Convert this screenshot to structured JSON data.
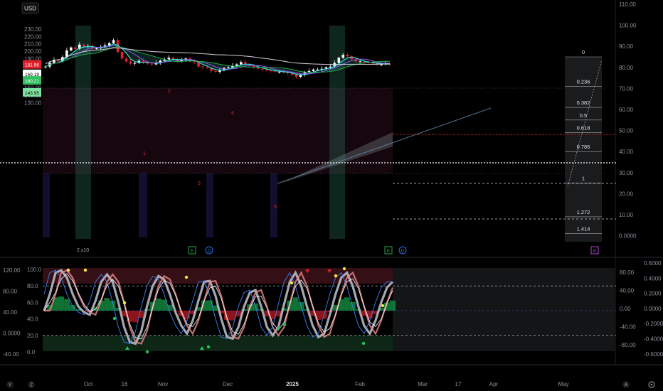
{
  "currency_button": "USD",
  "price_axis": {
    "labels": [
      "230.00",
      "220.00",
      "210.00",
      "200.00",
      "190.00",
      "180.00",
      "170.00",
      "160.00",
      "150.00",
      "140.00",
      "130.00"
    ],
    "values": [
      230,
      220,
      210,
      200,
      190,
      180,
      170,
      160,
      150,
      140,
      130
    ]
  },
  "right_axis": {
    "labels": [
      "110.00",
      "100.00",
      "90.00",
      "80.00",
      "70.00",
      "60.00",
      "50.00",
      "40.00",
      "30.00",
      "20.00",
      "10.00",
      "0.0000"
    ],
    "values": [
      110,
      100,
      90,
      80,
      70,
      60,
      50,
      40,
      30,
      20,
      10,
      0
    ]
  },
  "price_badges": [
    {
      "label": "181.96",
      "value": 181.96,
      "color": "#e0202a"
    },
    {
      "label": "169.19",
      "value": 169.19,
      "color": "#ffffff"
    },
    {
      "label": "160.21",
      "value": 160.21,
      "color": "#2fbf5f"
    },
    {
      "label": "143.95",
      "value": 143.95,
      "color": "#7ee0a0"
    }
  ],
  "fib_levels": [
    "0",
    "0.236",
    "0.382",
    "0.5",
    "0.618",
    "0.786",
    "1",
    "1.272",
    "1.414"
  ],
  "wave_labels": [
    "1",
    "2",
    "3",
    "4",
    "5"
  ],
  "scale_note": "2.x10",
  "osc_left_axis": {
    "labels": [
      "120.00",
      "80.00",
      "40.00",
      "0.0000",
      "-40.00"
    ],
    "values": [
      120,
      80,
      40,
      0,
      -40
    ]
  },
  "osc_inner_axis": {
    "labels": [
      "100.0",
      "80.0",
      "60.0",
      "40.0",
      "20.0",
      "0.0"
    ],
    "values": [
      100,
      80,
      60,
      40,
      20,
      0
    ]
  },
  "osc_right_axis_1": {
    "labels": [
      "80.00",
      "40.00",
      "0.00",
      "-40.00",
      "-80.00"
    ],
    "values": [
      80,
      40,
      0,
      -40,
      -80
    ]
  },
  "osc_right_axis_2": {
    "labels": [
      "0.6000",
      "0.4000",
      "0.2000",
      "0.0000",
      "-0.2000",
      "-0.4000",
      "-0.6000"
    ],
    "values": [
      0.6,
      0.4,
      0.2,
      0,
      -0.2,
      -0.4,
      -0.6
    ]
  },
  "time_axis": {
    "labels": [
      "Oct",
      "16",
      "Nov",
      "Dec",
      "2025",
      "Feb",
      "Mar",
      "17",
      "Apr",
      "May"
    ],
    "bold": [
      "2025"
    ]
  },
  "event_markers": [
    "E",
    "D",
    "E",
    "D",
    "E"
  ],
  "corner_icons": [
    "Y",
    "Z",
    "A",
    "gear-icon"
  ],
  "colors": {
    "bg": "#000000",
    "up_candle": "#ffffff",
    "down_candle": "#e0202a",
    "cyan": "#2ee6d6",
    "green": "#1fa84a",
    "purple": "#8a5cf6",
    "pink": "#ff6fa5",
    "accent_red": "#e0202a"
  },
  "chart_data": [
    {
      "type": "candlestick",
      "title": "",
      "currency": "USD",
      "ylim": [
        125,
        235
      ],
      "x_labels": [
        "Oct",
        "16",
        "Nov",
        "Dec",
        "2025",
        "Feb",
        "Mar",
        "17",
        "Apr",
        "May"
      ],
      "close": [
        179,
        184,
        188,
        186,
        192,
        201,
        205,
        203,
        209,
        206,
        207,
        203,
        204,
        206,
        208,
        211,
        215,
        199,
        190,
        186,
        183,
        184,
        187,
        185,
        183,
        182,
        184,
        187,
        189,
        191,
        189,
        186,
        188,
        190,
        186,
        185,
        179,
        178,
        177,
        173,
        172,
        174,
        177,
        178,
        180,
        182,
        185,
        182,
        180,
        178,
        176,
        175,
        174,
        173,
        172,
        172,
        171,
        170,
        168,
        165,
        168,
        171,
        173,
        175,
        175,
        176,
        178,
        179,
        184,
        191,
        195,
        193,
        189,
        186,
        186,
        185,
        184,
        183,
        182,
        182,
        183,
        182
      ],
      "events": {
        "last_price": 181.96,
        "support": 169.19,
        "low_1": 160.21,
        "low_2": 143.95
      },
      "fibonacci": [
        {
          "level": "0",
          "value": 85
        },
        {
          "level": "0.236",
          "value": 71
        },
        {
          "level": "0.382",
          "value": 61
        },
        {
          "level": "0.5",
          "value": 55
        },
        {
          "level": "0.618",
          "value": 49
        },
        {
          "level": "0.786",
          "value": 40
        },
        {
          "level": "1",
          "value": 25
        },
        {
          "level": "1.272",
          "value": 9
        },
        {
          "level": "1.414",
          "value": 1
        }
      ]
    },
    {
      "type": "line",
      "title": "",
      "ylim": [
        -10,
        110
      ],
      "series": [
        {
          "values": [
            50,
            70,
            96,
            99,
            90,
            70,
            55,
            48,
            45,
            62,
            85,
            94,
            85,
            60,
            30,
            12,
            10,
            25,
            55,
            80,
            92,
            88,
            70,
            48,
            32,
            22,
            38,
            62,
            85,
            86,
            68,
            40,
            18,
            16,
            30,
            55,
            72,
            75,
            55,
            30,
            20,
            30,
            58,
            85,
            96,
            80,
            55,
            32,
            18,
            22,
            45,
            70,
            90,
            96,
            80,
            55,
            32,
            22,
            38,
            60,
            78,
            85
          ]
        }
      ]
    }
  ]
}
